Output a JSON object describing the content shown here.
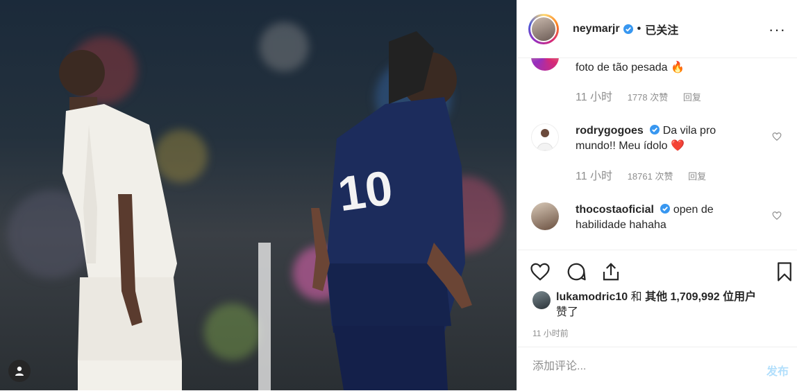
{
  "post": {
    "image_icon": "user-silhouette-icon"
  },
  "header": {
    "username": "neymarjr",
    "follow_status": "已关注",
    "more_icon": "more-options-icon"
  },
  "comments": [
    {
      "text": "foto de tão pesada 🔥",
      "time": "11 小时",
      "likes": "1778 次赞",
      "reply": "回复"
    },
    {
      "username": "rodrygogoes",
      "text": "Da vila pro mundo!! Meu ídolo ❤️",
      "time": "11 小时",
      "likes": "18761 次赞",
      "reply": "回复"
    },
    {
      "username": "thocostaoficial",
      "text": "open de habilidade hahaha"
    }
  ],
  "actions": {
    "like_icon": "heart-icon",
    "comment_icon": "comment-icon",
    "share_icon": "share-icon",
    "save_icon": "bookmark-icon"
  },
  "likes": {
    "username": "lukamodric10",
    "and": "和",
    "others": "其他 1,709,992 位用户",
    "suffix": "赞了"
  },
  "post_time": "11 小时前",
  "composer": {
    "placeholder": "添加评论...",
    "post_label": "发布"
  },
  "colors": {
    "verified": "#3897f0",
    "text": "#262626",
    "muted": "#8e8e8e",
    "post_disabled": "#b2dffc",
    "heart_red": "#ed4956"
  }
}
